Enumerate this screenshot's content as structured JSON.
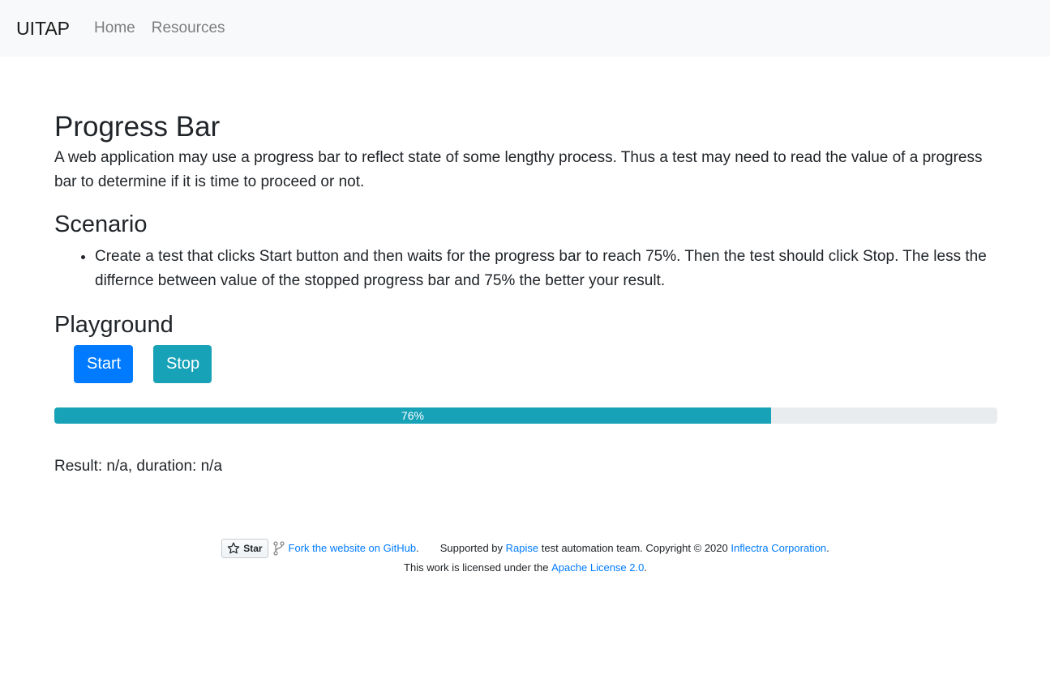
{
  "nav": {
    "brand": "UITAP",
    "links": [
      "Home",
      "Resources"
    ]
  },
  "page": {
    "title": "Progress Bar",
    "description": "A web application may use a progress bar to reflect state of some lengthy process. Thus a test may need to read the value of a progress bar to determine if it is time to proceed or not.",
    "scenario_heading": "Scenario",
    "scenario_items": [
      "Create a test that clicks Start button and then waits for the progress bar to reach 75%. Then the test should click Stop. The less the differnce between value of the stopped progress bar and 75% the better your result."
    ],
    "playground_heading": "Playground"
  },
  "playground": {
    "start_label": "Start",
    "stop_label": "Stop",
    "progress_value": 76,
    "progress_label": "76%",
    "result_text": "Result: n/a, duration: n/a"
  },
  "footer": {
    "star_label": "Star",
    "fork_link": "Fork the website on GitHub",
    "fork_suffix": ".",
    "supported_by": "Supported by",
    "rapise_link": "Rapise",
    "copyright_text": "test automation team. Copyright © 2020",
    "inflectra_link": "Inflectra Corporation",
    "inflectra_suffix": ".",
    "license_prefix": "This work is licensed under the",
    "license_link": "Apache License 2.0",
    "license_suffix": "."
  },
  "colors": {
    "primary": "#007bff",
    "info": "#17a2b8",
    "progress_track": "#e9ecef",
    "navbar_bg": "#f8f9fa"
  }
}
